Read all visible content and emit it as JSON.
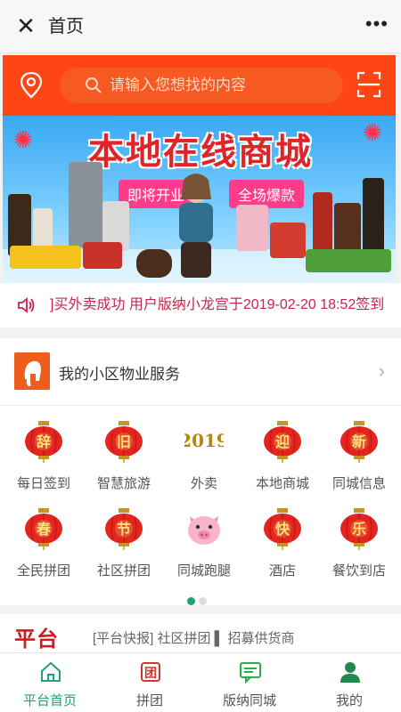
{
  "titlebar": {
    "title": "首页",
    "close_icon": "close-icon",
    "more_icon": "more-icon"
  },
  "search": {
    "placeholder": "请输入您想找的内容",
    "location_icon": "location-icon",
    "scan_icon": "scan-icon"
  },
  "banner": {
    "headline": "本地在线商城",
    "tag_left": "即将开业",
    "tag_right": "全场爆款"
  },
  "ticker": {
    "message": "]买外卖成功 用户版纳小龙宫于2019-02-20 18:52签到"
  },
  "service": {
    "label": "我的小区物业服务"
  },
  "grid": [
    {
      "icon": "辞",
      "label": "每日签到",
      "type": "lantern"
    },
    {
      "icon": "旧",
      "label": "智慧旅游",
      "type": "lantern"
    },
    {
      "icon": "2019",
      "label": "外卖",
      "type": "text2019"
    },
    {
      "icon": "迎",
      "label": "本地商城",
      "type": "lantern"
    },
    {
      "icon": "新",
      "label": "同城信息",
      "type": "lantern"
    },
    {
      "icon": "春",
      "label": "全民拼团",
      "type": "lantern"
    },
    {
      "icon": "节",
      "label": "社区拼团",
      "type": "lantern"
    },
    {
      "icon": "pig",
      "label": "同城跑腿",
      "type": "pig"
    },
    {
      "icon": "快",
      "label": "酒店",
      "type": "lantern"
    },
    {
      "icon": "乐",
      "label": "餐饮到店",
      "type": "lantern"
    }
  ],
  "pager": {
    "active": 0,
    "count": 2,
    "active_color": "#21a07b",
    "inactive_color": "#dddddd"
  },
  "news": {
    "logo_text": "平台",
    "text": "[平台快报] 社区拼团 ▌ 招募供货商"
  },
  "tabs": [
    {
      "label": "平台首页",
      "icon": "home-icon",
      "active": true
    },
    {
      "label": "拼团",
      "icon": "group-icon",
      "active": false
    },
    {
      "label": "版纳同城",
      "icon": "message-icon",
      "active": false
    },
    {
      "label": "我的",
      "icon": "user-icon",
      "active": false
    }
  ],
  "colors": {
    "accent": "#ff4514",
    "brand_green": "#21a07b",
    "lantern": "#e3241f"
  }
}
